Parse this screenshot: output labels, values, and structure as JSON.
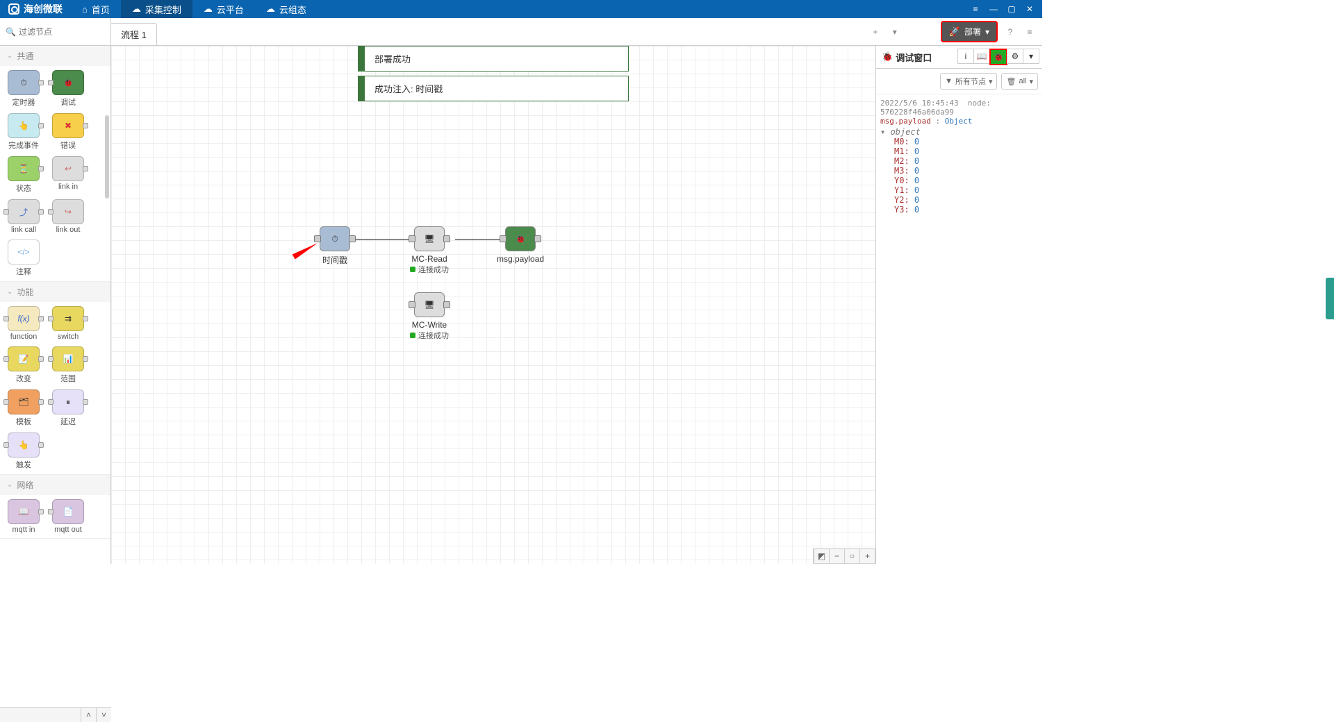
{
  "brand": "海创微联",
  "menu": {
    "home": "首页",
    "collect": "采集控制",
    "cloud": "云平台",
    "config": "云组态"
  },
  "search": {
    "placeholder": "过滤节点"
  },
  "tabs": {
    "flow1": "流程 1"
  },
  "header": {
    "deploy": "部署"
  },
  "palette": {
    "section_common": "共通",
    "section_function": "功能",
    "section_network": "网络",
    "nodes": {
      "timer": "定时器",
      "debug": "调试",
      "complete": "完成事件",
      "error": "错误",
      "status": "状态",
      "linkin": "link in",
      "linkcall": "link call",
      "linkout": "link out",
      "comment": "注释",
      "function": "function",
      "switch": "switch",
      "change": "改变",
      "range": "范围",
      "template": "模板",
      "delay": "延迟",
      "trigger": "触发",
      "mqttin": "mqtt in",
      "mqttout": "mqtt out"
    }
  },
  "notifications": {
    "deploy_ok": "部署成功",
    "inject_ok": "成功注入: 时间戳"
  },
  "flow": {
    "inject": "时间戳",
    "mcread": "MC-Read",
    "mcread_status": "连接成功",
    "debug": "msg.payload",
    "mcwrite": "MC-Write",
    "mcwrite_status": "连接成功"
  },
  "sidebar": {
    "title": "调试窗口",
    "filter_all": "所有节点",
    "trash_all": "all",
    "log": {
      "time": "2022/5/6 10:45:43",
      "node": "node: 570228f46a06da99",
      "payload_key": "msg.payload",
      "payload_type": "Object",
      "object": "object",
      "entries": [
        {
          "k": "M0",
          "v": "0"
        },
        {
          "k": "M1",
          "v": "0"
        },
        {
          "k": "M2",
          "v": "0"
        },
        {
          "k": "M3",
          "v": "0"
        },
        {
          "k": "Y0",
          "v": "0"
        },
        {
          "k": "Y1",
          "v": "0"
        },
        {
          "k": "Y2",
          "v": "0"
        },
        {
          "k": "Y3",
          "v": "0"
        }
      ]
    }
  }
}
